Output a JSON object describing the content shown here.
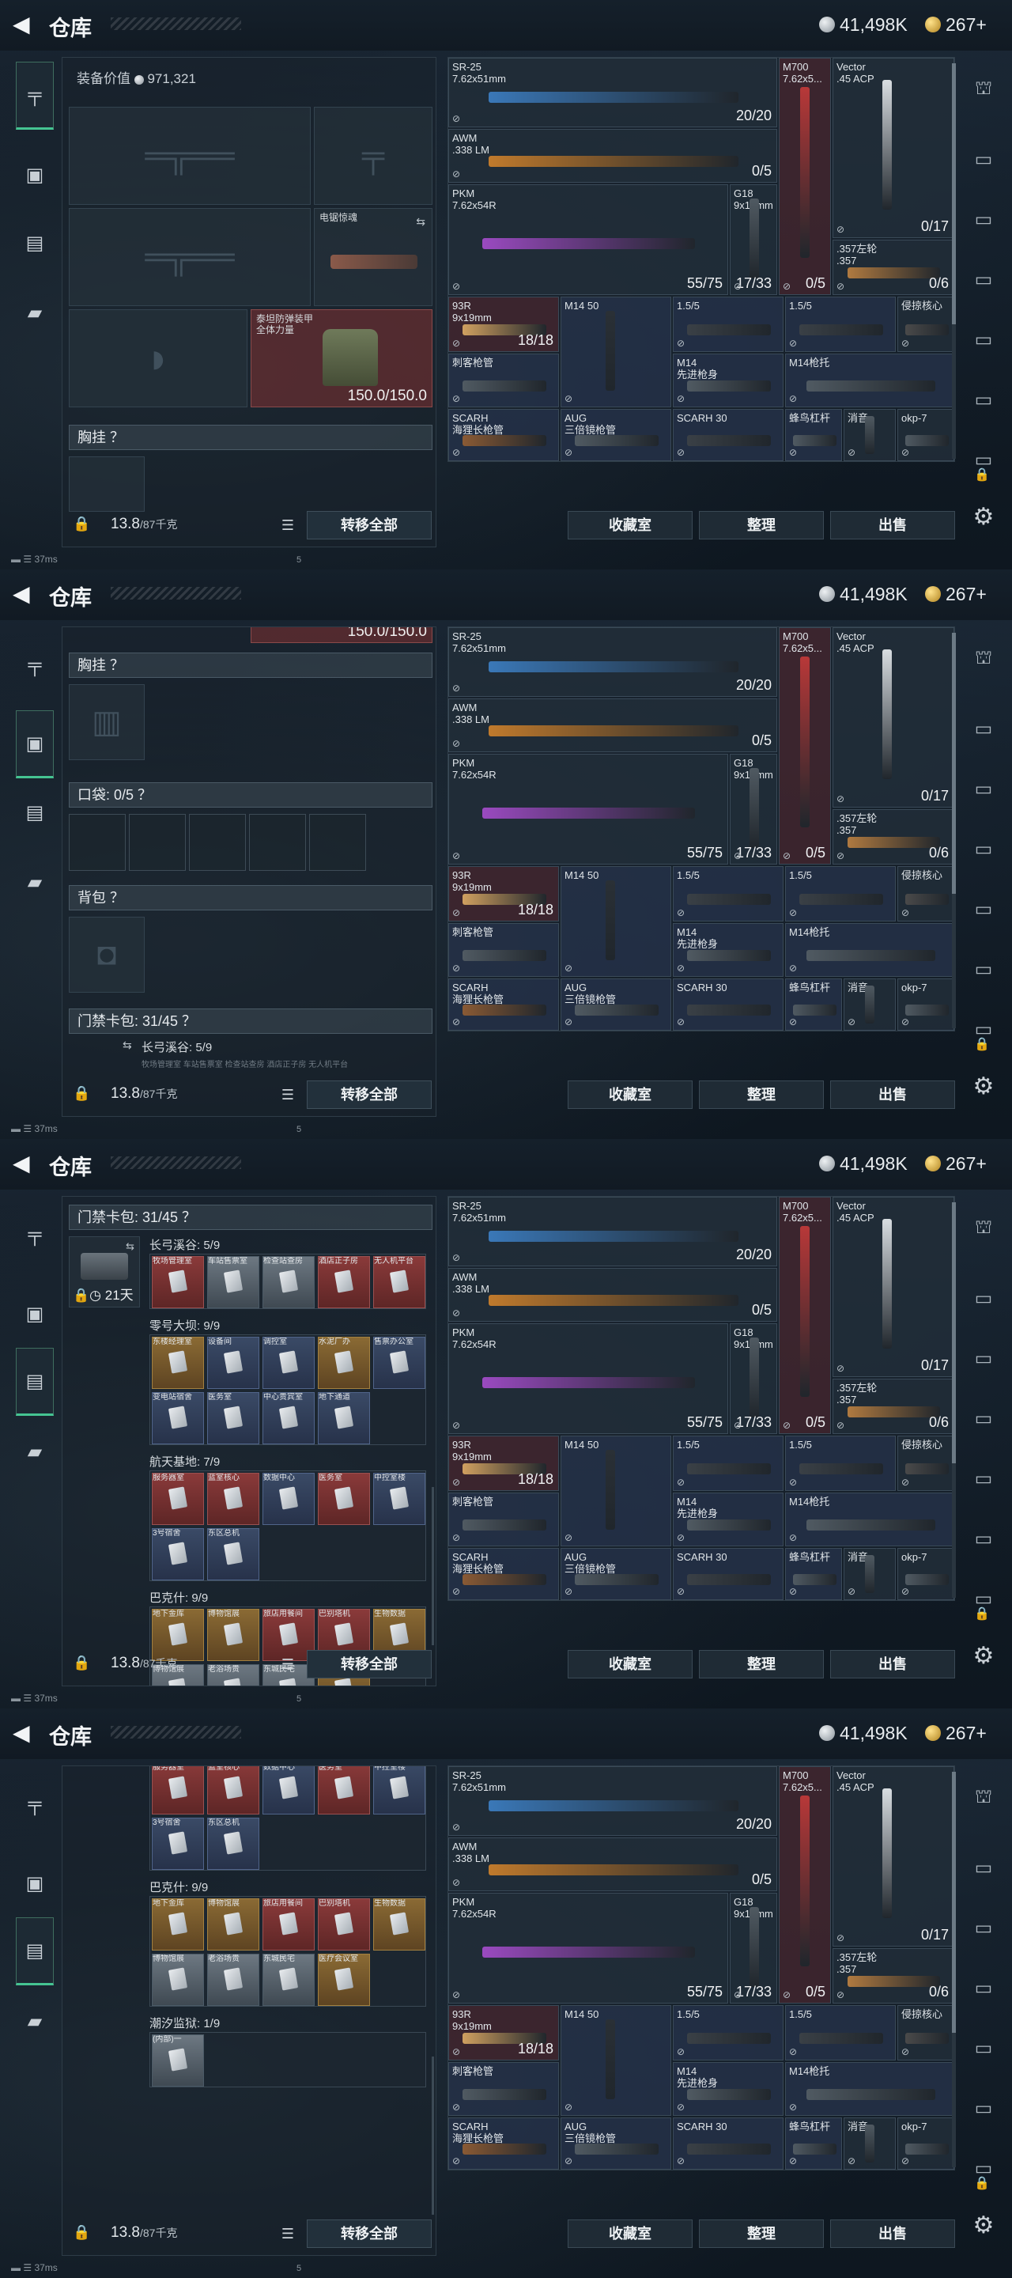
{
  "header": {
    "title": "仓库",
    "silver": "41,498K",
    "gold": "267+"
  },
  "equip_value_label": "装备价值",
  "equip_value": "971,321",
  "slots": {
    "scope_name": "电锯惊魂",
    "armor_name": "泰坦防弹装甲",
    "armor_sub": "全体力量",
    "armor_durability": "150.0/150.0"
  },
  "sections": {
    "chest": "胸挂 ？",
    "pocket": "口袋: 0/5 ？",
    "backpack": "背包 ？",
    "keycard": "门禁卡包: 31/45 ？"
  },
  "keycard_timer": "21天",
  "keycard_groups": [
    {
      "title": "长弓溪谷: 5/9",
      "cards": [
        "牧场管理室",
        "车站售票室",
        "检查站查房",
        "酒店正子房",
        "无人机平台"
      ]
    },
    {
      "title": "零号大坝: 9/9",
      "cards": [
        "东楼经理室",
        "设备间",
        "调控室",
        "水泥厂办",
        "售票办公室",
        "变电站宿舍",
        "医务室",
        "中心贵宾室",
        "地下通道"
      ]
    },
    {
      "title": "航天基地: 7/9",
      "cards": [
        "服务器室",
        "蓝室核心",
        "数据中心",
        "医务室",
        "中控室楼",
        "3号宿舍",
        "东区总机"
      ]
    },
    {
      "title": "巴克什: 9/9",
      "cards": [
        "地下金库",
        "博物馆展",
        "旅店用餐间",
        "巴别塔机",
        "生物数据",
        "博物馆展",
        "老浴场贵",
        "东城民宅",
        "医疗会议室"
      ]
    },
    {
      "title": "潮汐监狱: 1/9",
      "cards": [
        "(内部)一"
      ]
    }
  ],
  "partial_texts": {
    "keycard_tail": "长弓溪谷: 5/9",
    "s2_hint": "牧场管理室  车站售票室  检查站查房  酒店正子房  无人机平台"
  },
  "bottom": {
    "weight": "13.8",
    "weight_unit": "/87千克",
    "transfer": "转移全部"
  },
  "weapons": [
    {
      "name": "SR-25\n7.62x51mm",
      "count": "20/20"
    },
    {
      "name": "AWM\n.338 LM",
      "count": "0/5"
    },
    {
      "name": "PKM\n7.62x54R",
      "count": "55/75"
    },
    {
      "name": "G18\n9x19mm",
      "count": "17/33"
    },
    {
      "name": "M700\n7.62x5...",
      "count": "0/5"
    },
    {
      "name": "Vector\n.45 ACP",
      "count": "0/17"
    },
    {
      "name": ".357左轮\n.357",
      "count": "0/6"
    },
    {
      "name": "93R\n9x19mm",
      "count": "18/18"
    },
    {
      "name": "M14 50",
      "count": ""
    },
    {
      "name": "1.5/5",
      "count": ""
    },
    {
      "name": "1.5/5",
      "count": ""
    },
    {
      "name": "侵掠核心",
      "count": ""
    },
    {
      "name": "刺客枪管",
      "count": ""
    },
    {
      "name": "M14\n先进枪身",
      "count": ""
    },
    {
      "name": "M14枪托",
      "count": ""
    },
    {
      "name": "SCARH\n海狸长枪管",
      "count": ""
    },
    {
      "name": "AUG\n三倍镜枪管",
      "count": ""
    },
    {
      "name": "SCARH 30",
      "count": ""
    },
    {
      "name": "蜂鸟杠杆",
      "count": ""
    },
    {
      "name": "消音",
      "count": ""
    },
    {
      "name": "okp-7",
      "count": ""
    }
  ],
  "actions": {
    "collection": "收藏室",
    "sort": "整理",
    "sell": "出售"
  },
  "status": {
    "ping": "37ms",
    "fps": "5"
  }
}
